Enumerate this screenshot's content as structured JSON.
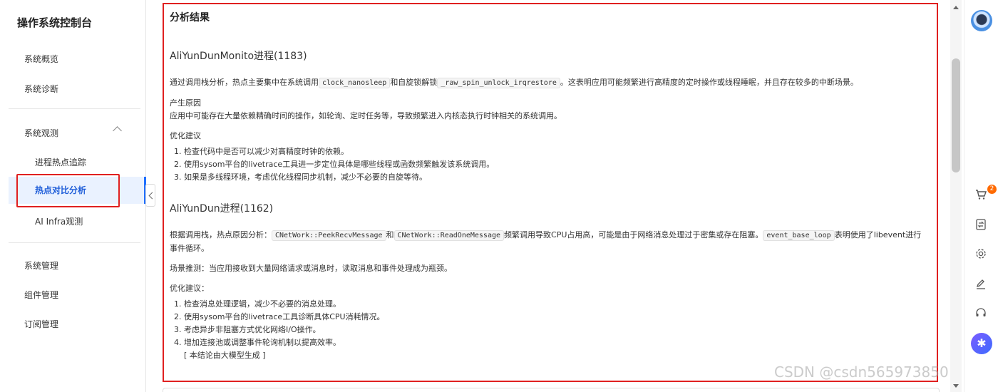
{
  "sidebar": {
    "title": "操作系统控制台",
    "items": {
      "overview": "系统概览",
      "diagnosis": "系统诊断",
      "observe": "系统观测",
      "hotspot_trace": "进程热点追踪",
      "hotspot_compare": "热点对比分析",
      "ai_infra": "AI Infra观测",
      "manage": "系统管理",
      "components": "组件管理",
      "subscription": "订阅管理"
    }
  },
  "main": {
    "section_title": "分析结果",
    "p1": {
      "title": "AliYunDunMonito进程(1183)",
      "text_a": "通过调用栈分析，热点主要集中在系统调用",
      "code1": "clock_nanosleep",
      "text_b": "和自旋锁解锁",
      "code2": "_raw_spin_unlock_irqrestore",
      "text_c": "。这表明应用可能频繁进行高精度的定时操作或线程睡眠，并且存在较多的中断场景。",
      "cause_head": "产生原因",
      "cause_text": "应用中可能存在大量依赖精确时间的操作，如轮询、定时任务等，导致频繁进入内核态执行时钟相关的系统调用。",
      "advice_head": "优化建议",
      "advice": [
        "检查代码中是否可以减少对高精度时钟的依赖。",
        "使用sysom平台的livetrace工具进一步定位具体是哪些线程或函数频繁触发该系统调用。",
        "如果是多线程环境，考虑优化线程同步机制，减少不必要的自旋等待。"
      ]
    },
    "p2": {
      "title": "AliYunDun进程(1162)",
      "text_a": "根据调用栈，热点原因分析：",
      "code1": "CNetWork::PeekRecvMessage",
      "text_b": "和",
      "code2": "CNetWork::ReadOneMessage",
      "text_c": "频繁调用导致CPU占用高，可能是由于网络消息处理过于密集或存在阻塞。",
      "code3": "event_base_loop",
      "text_d": "表明使用了libevent进行事件循环。",
      "scene": "场景推测：当应用接收到大量网络请求或消息时，读取消息和事件处理成为瓶颈。",
      "advice_head": "优化建议：",
      "advice": [
        "检查消息处理逻辑，减少不必要的消息处理。",
        "使用sysom平台的livetrace工具诊断具体CPU消耗情况。",
        "考虑异步非阻塞方式优化网络I/O操作。",
        "增加连接池或调整事件轮询机制以提高效率。"
      ],
      "note": "[ 本结论由大模型生成 ]"
    }
  },
  "rail": {
    "cart_badge": "2"
  },
  "watermark": "CSDN @csdn565973850"
}
